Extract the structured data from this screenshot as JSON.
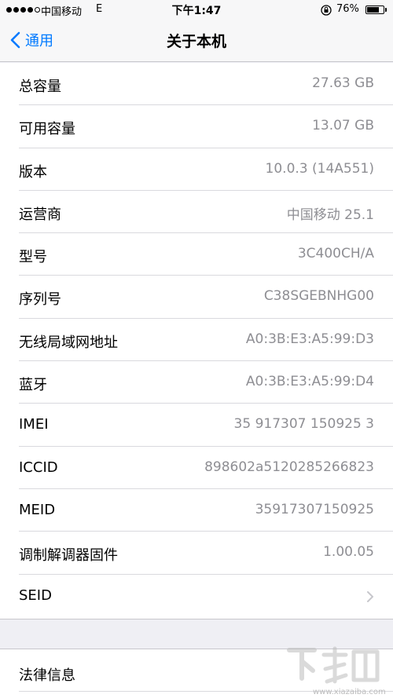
{
  "status_bar": {
    "carrier": "中国移动",
    "network": "E",
    "time": "下午1:47",
    "battery_percent": "76%",
    "battery_level": 0.76,
    "signal_bars_filled": 4,
    "signal_bars_total": 5,
    "icons": [
      "signal-dots",
      "rotation-lock-icon",
      "battery-icon"
    ]
  },
  "nav": {
    "back_label": "通用",
    "title": "关于本机"
  },
  "about": {
    "rows": [
      {
        "label": "总容量",
        "value": "27.63 GB"
      },
      {
        "label": "可用容量",
        "value": "13.07 GB"
      },
      {
        "label": "版本",
        "value": "10.0.3 (14A551)"
      },
      {
        "label": "运营商",
        "value": "中国移动 25.1"
      },
      {
        "label": "型号",
        "value": "3C400CH/A"
      },
      {
        "label": "序列号",
        "value": "C38SGEBNHG00"
      },
      {
        "label": "无线局域网地址",
        "value": "A0:3B:E3:A5:99:D3"
      },
      {
        "label": "蓝牙",
        "value": "A0:3B:E3:A5:99:D4"
      },
      {
        "label": "IMEI",
        "value": "35 917307 150925 3"
      },
      {
        "label": "ICCID",
        "value": "898602a5120285266823"
      },
      {
        "label": "MEID",
        "value": "35917307150925"
      },
      {
        "label": "调制解调器固件",
        "value": "1.00.05"
      },
      {
        "label": "SEID",
        "value": ""
      }
    ],
    "legal_label": "法律信息"
  },
  "watermark": {
    "text": "www.xiazaiba.com"
  },
  "colors": {
    "accent": "#007aff",
    "background": "#efeff4",
    "value_gray": "#8e8e93",
    "separator": "#d9d9de"
  }
}
